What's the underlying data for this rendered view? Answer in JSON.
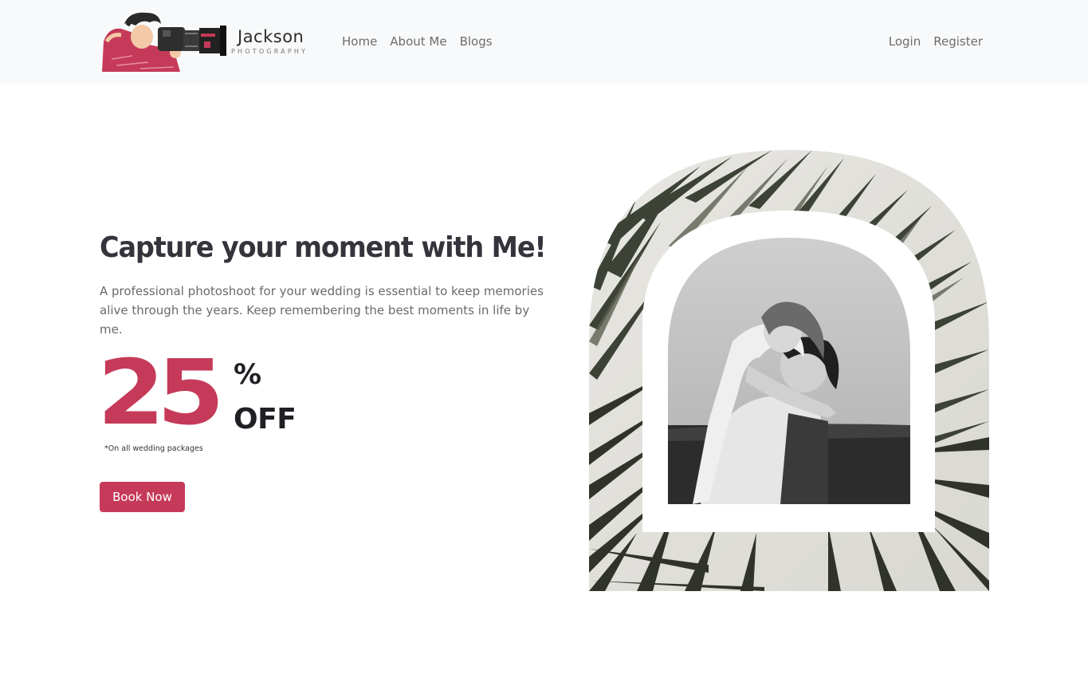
{
  "navbar": {
    "brand": {
      "name": "Jackson",
      "subtitle": "PHOTOGRAPHY",
      "illustration": "photographer-with-camera-logo"
    },
    "left_links": [
      {
        "label": "Home"
      },
      {
        "label": "About Me"
      },
      {
        "label": "Blogs"
      }
    ],
    "right_links": [
      {
        "label": "Login"
      },
      {
        "label": "Register"
      }
    ]
  },
  "hero": {
    "title": "Capture your moment with Me!",
    "description": "A professional photoshoot for your wedding is essential to keep memories alive through the years. Keep remembering the best moments in life by me.",
    "promo": {
      "number": "25",
      "percent": "%",
      "off": "OFF",
      "note": "*On all wedding packages"
    },
    "cta_label": "Book Now",
    "image": {
      "subject": "couple-embrace-photo",
      "frame": "arch-with-palm-leaves"
    }
  },
  "colors": {
    "accent": "#c63a59",
    "navbar_bg": "#f8f9fa",
    "heading": "#35333b",
    "text_muted": "#6a6a6a",
    "leaf": "#3c4236"
  }
}
